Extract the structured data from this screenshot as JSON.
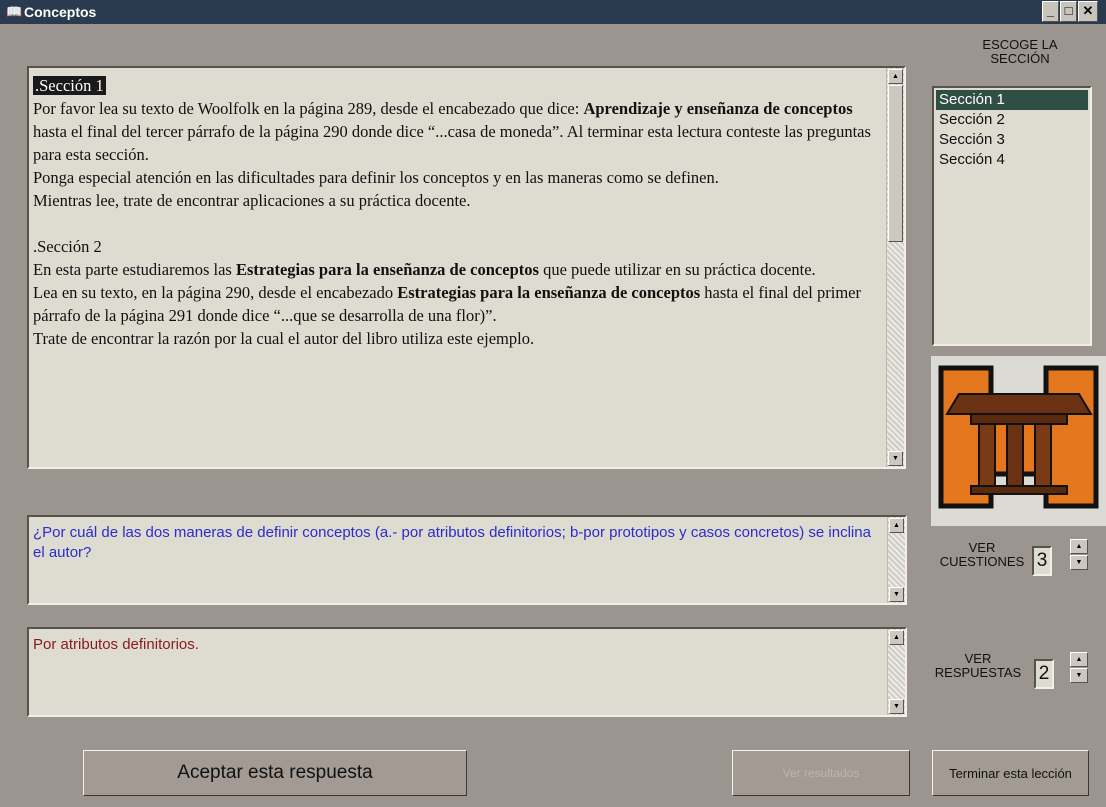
{
  "window": {
    "title": "Conceptos",
    "app_icon": "book-icon",
    "controls": {
      "minimize": "_",
      "maximize": "□",
      "close": "✕"
    }
  },
  "reading": {
    "blocks": [
      {
        "kind": "heading",
        "text": ".Sección 1"
      },
      {
        "kind": "para",
        "segments": [
          {
            "t": "Por favor lea su texto de Woolfolk en la página 289, desde el encabezado que dice: "
          },
          {
            "t": "Aprendizaje y enseñanza de conceptos",
            "b": true
          },
          {
            "t": " hasta el final del tercer párrafo de la página 290 donde dice “...casa de moneda”. Al terminar esta lectura conteste las preguntas para esta sección."
          }
        ]
      },
      {
        "kind": "para",
        "segments": [
          {
            "t": "Ponga especial atención en las dificultades para definir los conceptos y en las maneras como se definen."
          }
        ]
      },
      {
        "kind": "para",
        "segments": [
          {
            "t": "Mientras lee, trate de encontrar aplicaciones a su práctica docente."
          }
        ]
      },
      {
        "kind": "gap"
      },
      {
        "kind": "para",
        "segments": [
          {
            "t": ".Sección 2"
          }
        ]
      },
      {
        "kind": "para",
        "segments": [
          {
            "t": "En esta parte estudiaremos las "
          },
          {
            "t": "Estrategias para la enseñanza de conceptos",
            "b": true
          },
          {
            "t": " que puede utilizar en su práctica docente."
          }
        ]
      },
      {
        "kind": "para",
        "segments": [
          {
            "t": "Lea en su texto, en la página 290, desde el encabezado "
          },
          {
            "t": "Estrategias para la enseñanza de conceptos",
            "b": true
          },
          {
            "t": " hasta el final del primer párrafo de la página 291 donde dice “...que se desarrolla de una flor)”."
          }
        ]
      },
      {
        "kind": "para",
        "segments": [
          {
            "t": "Trate de encontrar la razón por la cual el autor del libro utiliza este ejemplo."
          }
        ]
      }
    ],
    "scroll_up_icon": "▲",
    "scroll_down_icon": "▼"
  },
  "section_picker": {
    "heading_line1": "ESCOGE LA",
    "heading_line2": "SECCIÓN",
    "items": [
      "Sección 1",
      "Sección 2",
      "Sección 3",
      "Sección 4"
    ],
    "selected_index": 0
  },
  "logo": {
    "icon": "temple-icon"
  },
  "question": {
    "text": "¿Por cuál de las dos maneras de definir conceptos (a.- por atributos definitorios; b-por prototipos y casos concretos) se inclina el autor?",
    "color": "#2c2ccc"
  },
  "answer": {
    "text": "Por atributos definitorios.",
    "color": "#8b1a1a"
  },
  "ver_cuestiones": {
    "label_line1": "VER",
    "label_line2": "CUESTIONES",
    "value": "3"
  },
  "ver_respuestas": {
    "label_line1": "VER",
    "label_line2": "RESPUESTAS",
    "value": "2"
  },
  "buttons": {
    "accept": "Aceptar esta respuesta",
    "results": "Ver resultados",
    "finish": "Terminar esta lección"
  }
}
